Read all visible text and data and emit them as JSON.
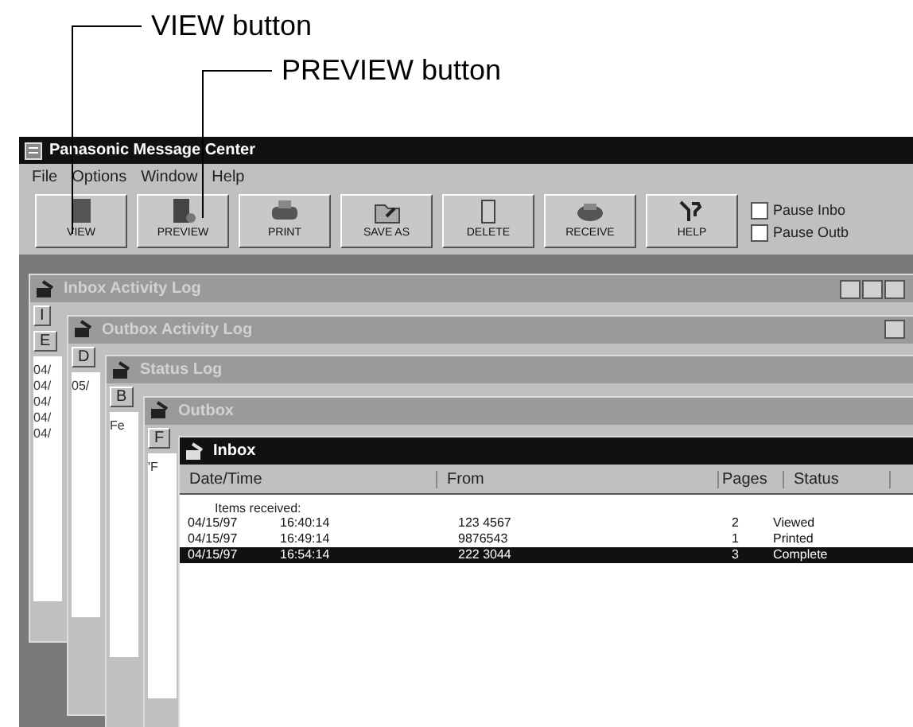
{
  "callouts": [
    {
      "label": "VIEW button"
    },
    {
      "label": "PREVIEW button"
    }
  ],
  "window": {
    "title": "Panasonic Message Center"
  },
  "menu": [
    "File",
    "Options",
    "Window",
    "Help"
  ],
  "toolbar": [
    {
      "label": "VIEW"
    },
    {
      "label": "PREVIEW"
    },
    {
      "label": "PRINT"
    },
    {
      "label": "SAVE AS"
    },
    {
      "label": "DELETE"
    },
    {
      "label": "RECEIVE"
    },
    {
      "label": "HELP"
    }
  ],
  "options": [
    {
      "label": "Pause Inbo",
      "checked": false
    },
    {
      "label": "Pause Outb",
      "checked": false
    }
  ],
  "windows": [
    {
      "title": "Inbox Activity Log",
      "active": false,
      "cells": [
        "I",
        "E"
      ],
      "lines": [
        "04/",
        "04/",
        "04/",
        "04/",
        "04/"
      ]
    },
    {
      "title": "Outbox Activity Log",
      "active": false,
      "cells": [
        "D"
      ],
      "lines": [
        "05/"
      ]
    },
    {
      "title": "Status Log",
      "active": false,
      "cells": [
        "B"
      ],
      "lines": [
        "Fe"
      ]
    },
    {
      "title": "Outbox",
      "active": false,
      "cells": [
        "F"
      ],
      "lines": [
        "'F"
      ]
    }
  ],
  "inbox": {
    "title": "Inbox",
    "active": true,
    "columns": [
      "Date/Time",
      "From",
      "Pages",
      "Status"
    ],
    "group": "Items received:",
    "rows": [
      {
        "date": "04/15/97",
        "time": "16:40:14",
        "from": "123 4567",
        "pages": "2",
        "status": "Viewed",
        "selected": false
      },
      {
        "date": "04/15/97",
        "time": "16:49:14",
        "from": "9876543",
        "pages": "1",
        "status": "Printed",
        "selected": false
      },
      {
        "date": "04/15/97",
        "time": "16:54:14",
        "from": "222 3044",
        "pages": "3",
        "status": "Complete",
        "selected": true
      }
    ]
  }
}
